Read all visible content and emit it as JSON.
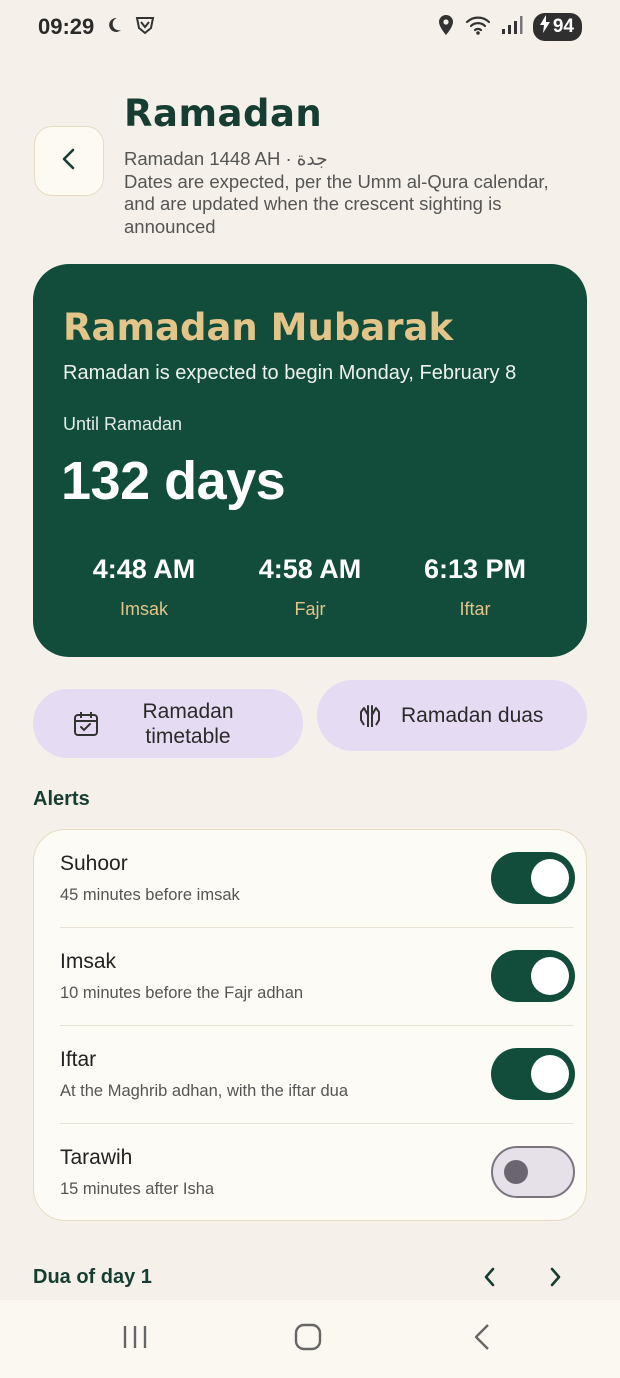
{
  "status_bar": {
    "time": "09:29",
    "battery": "94"
  },
  "header": {
    "title": "Ramadan",
    "subtitle_line": "Ramadan 1448 AH · جدة",
    "subtitle_note": "Dates are expected, per the Umm al-Qura calendar, and are updated when the crescent sighting is announced"
  },
  "hero": {
    "title": "Ramadan Mubarak",
    "subtitle": "Ramadan is expected to begin Monday, February 8",
    "until_label": "Until Ramadan",
    "countdown": "132 days",
    "times": [
      {
        "time": "4:48 AM",
        "label": "Imsak"
      },
      {
        "time": "4:58 AM",
        "label": "Fajr"
      },
      {
        "time": "6:13 PM",
        "label": "Iftar"
      }
    ]
  },
  "actions": {
    "timetable_label": "Ramadan timetable",
    "duas_label": "Ramadan duas"
  },
  "alerts": {
    "section_title": "Alerts",
    "items": [
      {
        "title": "Suhoor",
        "desc": "45 minutes before imsak",
        "enabled": true
      },
      {
        "title": "Imsak",
        "desc": "10 minutes before the Fajr adhan",
        "enabled": true
      },
      {
        "title": "Iftar",
        "desc": "At the Maghrib adhan, with the iftar dua",
        "enabled": true
      },
      {
        "title": "Tarawih",
        "desc": "15 minutes after Isha",
        "enabled": false
      }
    ]
  },
  "dua": {
    "section_title": "Dua of day 1"
  },
  "colors": {
    "brand_green": "#124d3b",
    "gold": "#e3c489",
    "lavender": "#e5dbf3",
    "background": "#f5f1ea"
  },
  "icons": {
    "back": "chevron-left-icon",
    "timetable": "calendar-check-icon",
    "duas": "praying-hands-icon"
  }
}
